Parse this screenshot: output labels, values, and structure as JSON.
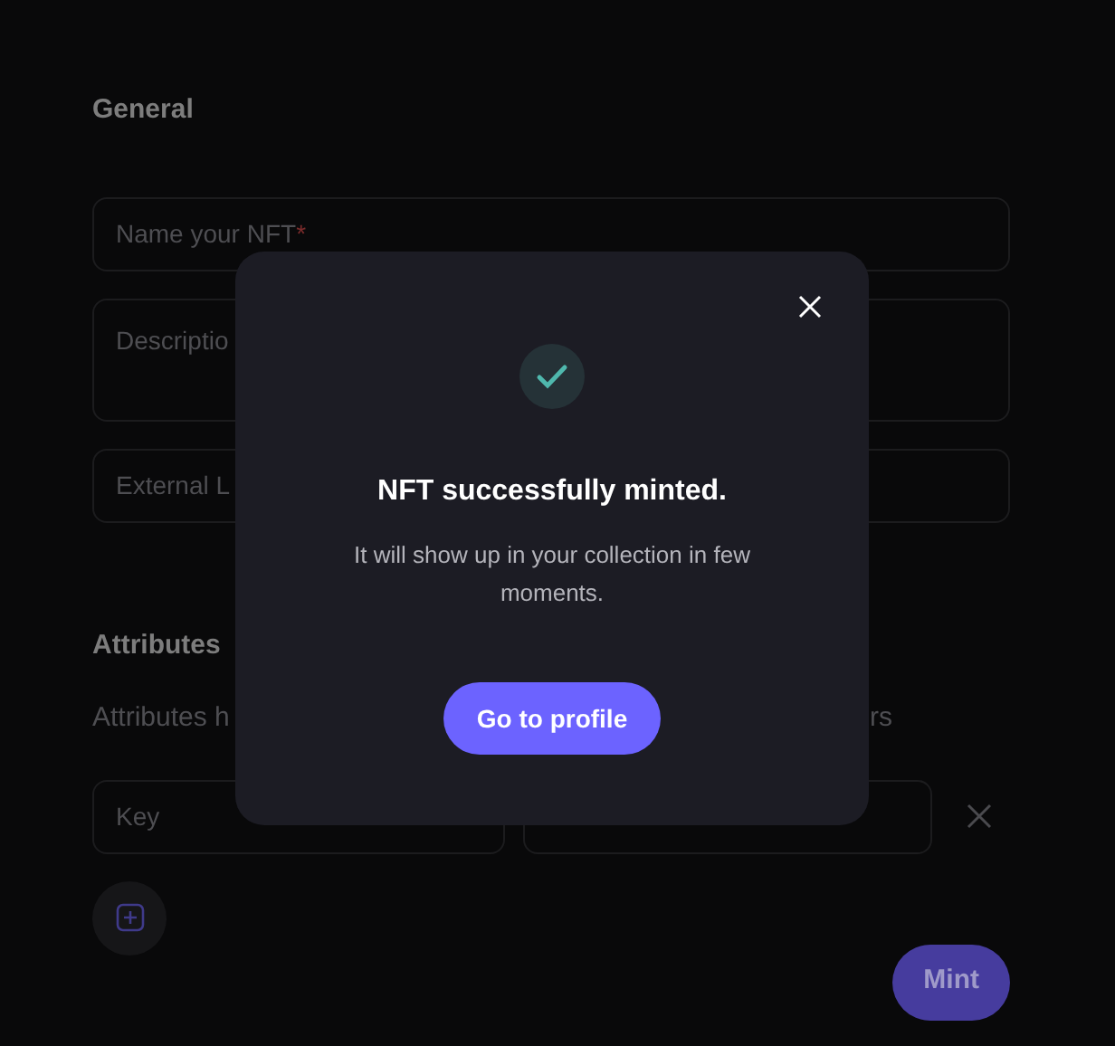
{
  "general": {
    "heading": "General",
    "fields": [
      {
        "kind": "input",
        "placeholder": "Name your NFT",
        "required_mark": "*"
      },
      {
        "kind": "textarea",
        "placeholder": "Descriptio"
      },
      {
        "kind": "input",
        "placeholder": "External L"
      }
    ]
  },
  "attributes": {
    "heading": "Attributes",
    "hint_left": "Attributes h",
    "hint_right": "rs",
    "rows": [
      {
        "key_placeholder": "Key"
      }
    ]
  },
  "mint_button": "Mint",
  "modal": {
    "title": "NFT successfully minted.",
    "body": "It will show up in your collection in few moments.",
    "button": "Go to profile"
  }
}
